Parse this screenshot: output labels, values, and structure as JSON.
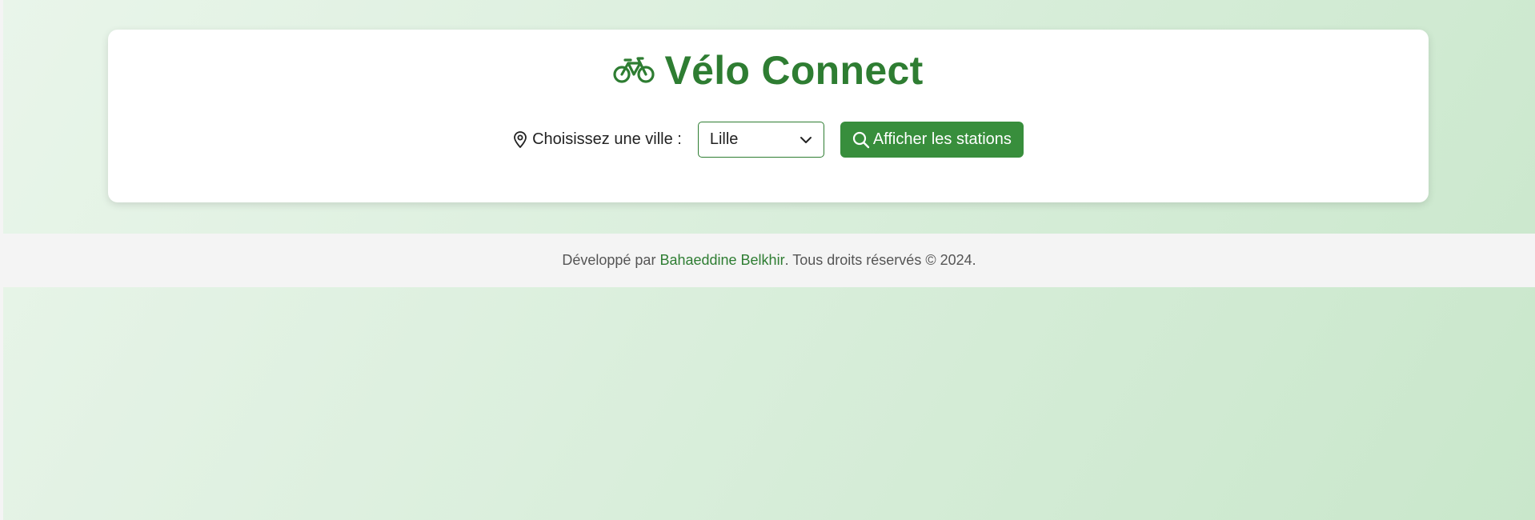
{
  "app": {
    "title": "Vélo Connect",
    "icon": "bicycle-icon",
    "accent_color": "#2e7d32",
    "button_color": "#388e3c"
  },
  "controls": {
    "city_label": "Choisissez une ville :",
    "city_icon": "map-pin-icon",
    "selected_city": "Lille",
    "search_button_label": "Afficher les stations",
    "search_icon": "search-icon"
  },
  "footer": {
    "prefix": "Développé par ",
    "author": "Bahaeddine Belkhir",
    "suffix": ". Tous droits réservés © 2024."
  }
}
